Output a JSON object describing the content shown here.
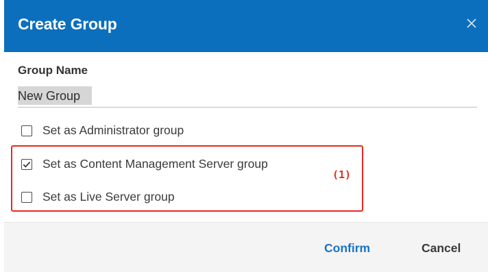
{
  "dialog": {
    "title": "Create Group",
    "close_icon": "close-icon"
  },
  "form": {
    "group_name_label": "Group Name",
    "group_name_value": "New Group"
  },
  "options": [
    {
      "label": "Set as Administrator group",
      "checked": false
    },
    {
      "label": "Set as Content Management Server group",
      "checked": true
    },
    {
      "label": "Set as Live Server group",
      "checked": false
    }
  ],
  "annotation": {
    "label": "(1)",
    "color": "#e8281e"
  },
  "footer": {
    "confirm_label": "Confirm",
    "cancel_label": "Cancel"
  },
  "colors": {
    "header": "#0b6fbd",
    "confirm": "#1a73c5"
  }
}
